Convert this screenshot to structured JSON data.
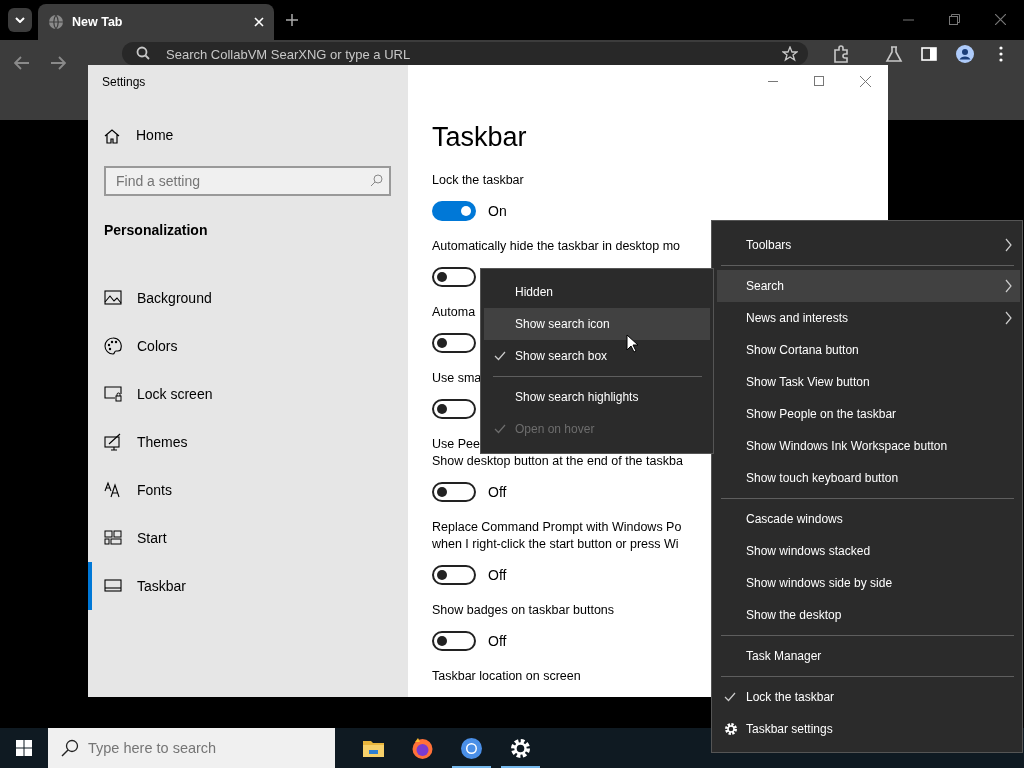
{
  "browser": {
    "tab": {
      "title": "New Tab",
      "selected": true
    },
    "address_bar": {
      "placeholder": "Search CollabVM SearXNG or type a URL"
    }
  },
  "settings_window": {
    "title": "Settings",
    "sidebar": {
      "home": "Home",
      "search": {
        "placeholder": "Find a setting"
      },
      "section": "Personalization",
      "items": [
        {
          "kind": "image",
          "label": "Background",
          "selected": false
        },
        {
          "kind": "palette",
          "label": "Colors",
          "selected": false
        },
        {
          "kind": "lockscreen",
          "label": "Lock screen",
          "selected": false
        },
        {
          "kind": "brush",
          "label": "Themes",
          "selected": false
        },
        {
          "kind": "font",
          "label": "Fonts",
          "selected": false
        },
        {
          "kind": "tiles",
          "label": "Start",
          "selected": false
        },
        {
          "kind": "taskbar",
          "label": "Taskbar",
          "selected": true
        }
      ]
    },
    "page": {
      "title": "Taskbar",
      "settings": [
        {
          "kind": "toggle",
          "label_lines": [
            "Lock the taskbar"
          ],
          "on": true,
          "state_text": "On"
        },
        {
          "kind": "toggle",
          "label_lines": [
            "Automatically hide the taskbar in desktop mo"
          ],
          "on": false
        },
        {
          "kind": "toggle",
          "label_lines": [
            "Automa"
          ],
          "on": false
        },
        {
          "kind": "toggle",
          "label_lines": [
            "Use sma"
          ],
          "on": false
        },
        {
          "kind": "toggle",
          "label_lines": [
            "Use Pee",
            "Show desktop button at the end of the taskba"
          ],
          "on": false,
          "state_text": "Off"
        },
        {
          "kind": "toggle",
          "label_lines": [
            "Replace Command Prompt with Windows Po",
            "when I right-click the start button or press Wi"
          ],
          "on": false,
          "state_text": "Off"
        },
        {
          "kind": "toggle",
          "label_lines": [
            "Show badges on taskbar buttons"
          ],
          "on": false,
          "state_text": "Off"
        },
        {
          "kind": "label",
          "label_lines": [
            "Taskbar location on screen"
          ]
        }
      ]
    }
  },
  "search_submenu": {
    "items": [
      {
        "kind": "item",
        "label": "Hidden",
        "checked": false,
        "hovered": false,
        "disabled": false
      },
      {
        "kind": "item",
        "label": "Show search icon",
        "checked": false,
        "hovered": true,
        "disabled": false
      },
      {
        "kind": "item",
        "label": "Show search box",
        "checked": true,
        "hovered": false,
        "disabled": false
      },
      {
        "kind": "separator"
      },
      {
        "kind": "item",
        "label": "Show search highlights",
        "checked": false,
        "hovered": false,
        "disabled": false
      },
      {
        "kind": "item",
        "label": "Open on hover",
        "checked": true,
        "hovered": false,
        "disabled": true
      }
    ]
  },
  "context_menu": {
    "items": [
      {
        "kind": "item",
        "label": "Toolbars",
        "submenu": true,
        "checked": false,
        "hovered": false
      },
      {
        "kind": "separator"
      },
      {
        "kind": "item",
        "label": "Search",
        "submenu": true,
        "checked": false,
        "hovered": true
      },
      {
        "kind": "item",
        "label": "News and interests",
        "submenu": true,
        "checked": false,
        "hovered": false
      },
      {
        "kind": "item",
        "label": "Show Cortana button",
        "submenu": false,
        "checked": false,
        "hovered": false
      },
      {
        "kind": "item",
        "label": "Show Task View button",
        "submenu": false,
        "checked": false,
        "hovered": false
      },
      {
        "kind": "item",
        "label": "Show People on the taskbar",
        "submenu": false,
        "checked": false,
        "hovered": false
      },
      {
        "kind": "item",
        "label": "Show Windows Ink Workspace button",
        "submenu": false,
        "checked": false,
        "hovered": false
      },
      {
        "kind": "item",
        "label": "Show touch keyboard button",
        "submenu": false,
        "checked": false,
        "hovered": false
      },
      {
        "kind": "separator"
      },
      {
        "kind": "item",
        "label": "Cascade windows",
        "submenu": false,
        "checked": false,
        "hovered": false
      },
      {
        "kind": "item",
        "label": "Show windows stacked",
        "submenu": false,
        "checked": false,
        "hovered": false
      },
      {
        "kind": "item",
        "label": "Show windows side by side",
        "submenu": false,
        "checked": false,
        "hovered": false
      },
      {
        "kind": "item",
        "label": "Show the desktop",
        "submenu": false,
        "checked": false,
        "hovered": false
      },
      {
        "kind": "separator"
      },
      {
        "kind": "item",
        "label": "Task Manager",
        "submenu": false,
        "checked": false,
        "hovered": false
      },
      {
        "kind": "separator"
      },
      {
        "kind": "item",
        "label": "Lock the taskbar",
        "submenu": false,
        "checked": true,
        "hovered": false
      },
      {
        "kind": "settings-item",
        "label": "Taskbar settings",
        "submenu": false,
        "checked": false,
        "hovered": false
      }
    ]
  },
  "taskbar": {
    "search": {
      "placeholder": "Type here to search"
    },
    "apps": [
      {
        "kind": "folder",
        "running": false
      },
      {
        "kind": "firefox",
        "running": false
      },
      {
        "kind": "chromium",
        "running": true
      },
      {
        "kind": "gear",
        "running": true
      }
    ]
  }
}
